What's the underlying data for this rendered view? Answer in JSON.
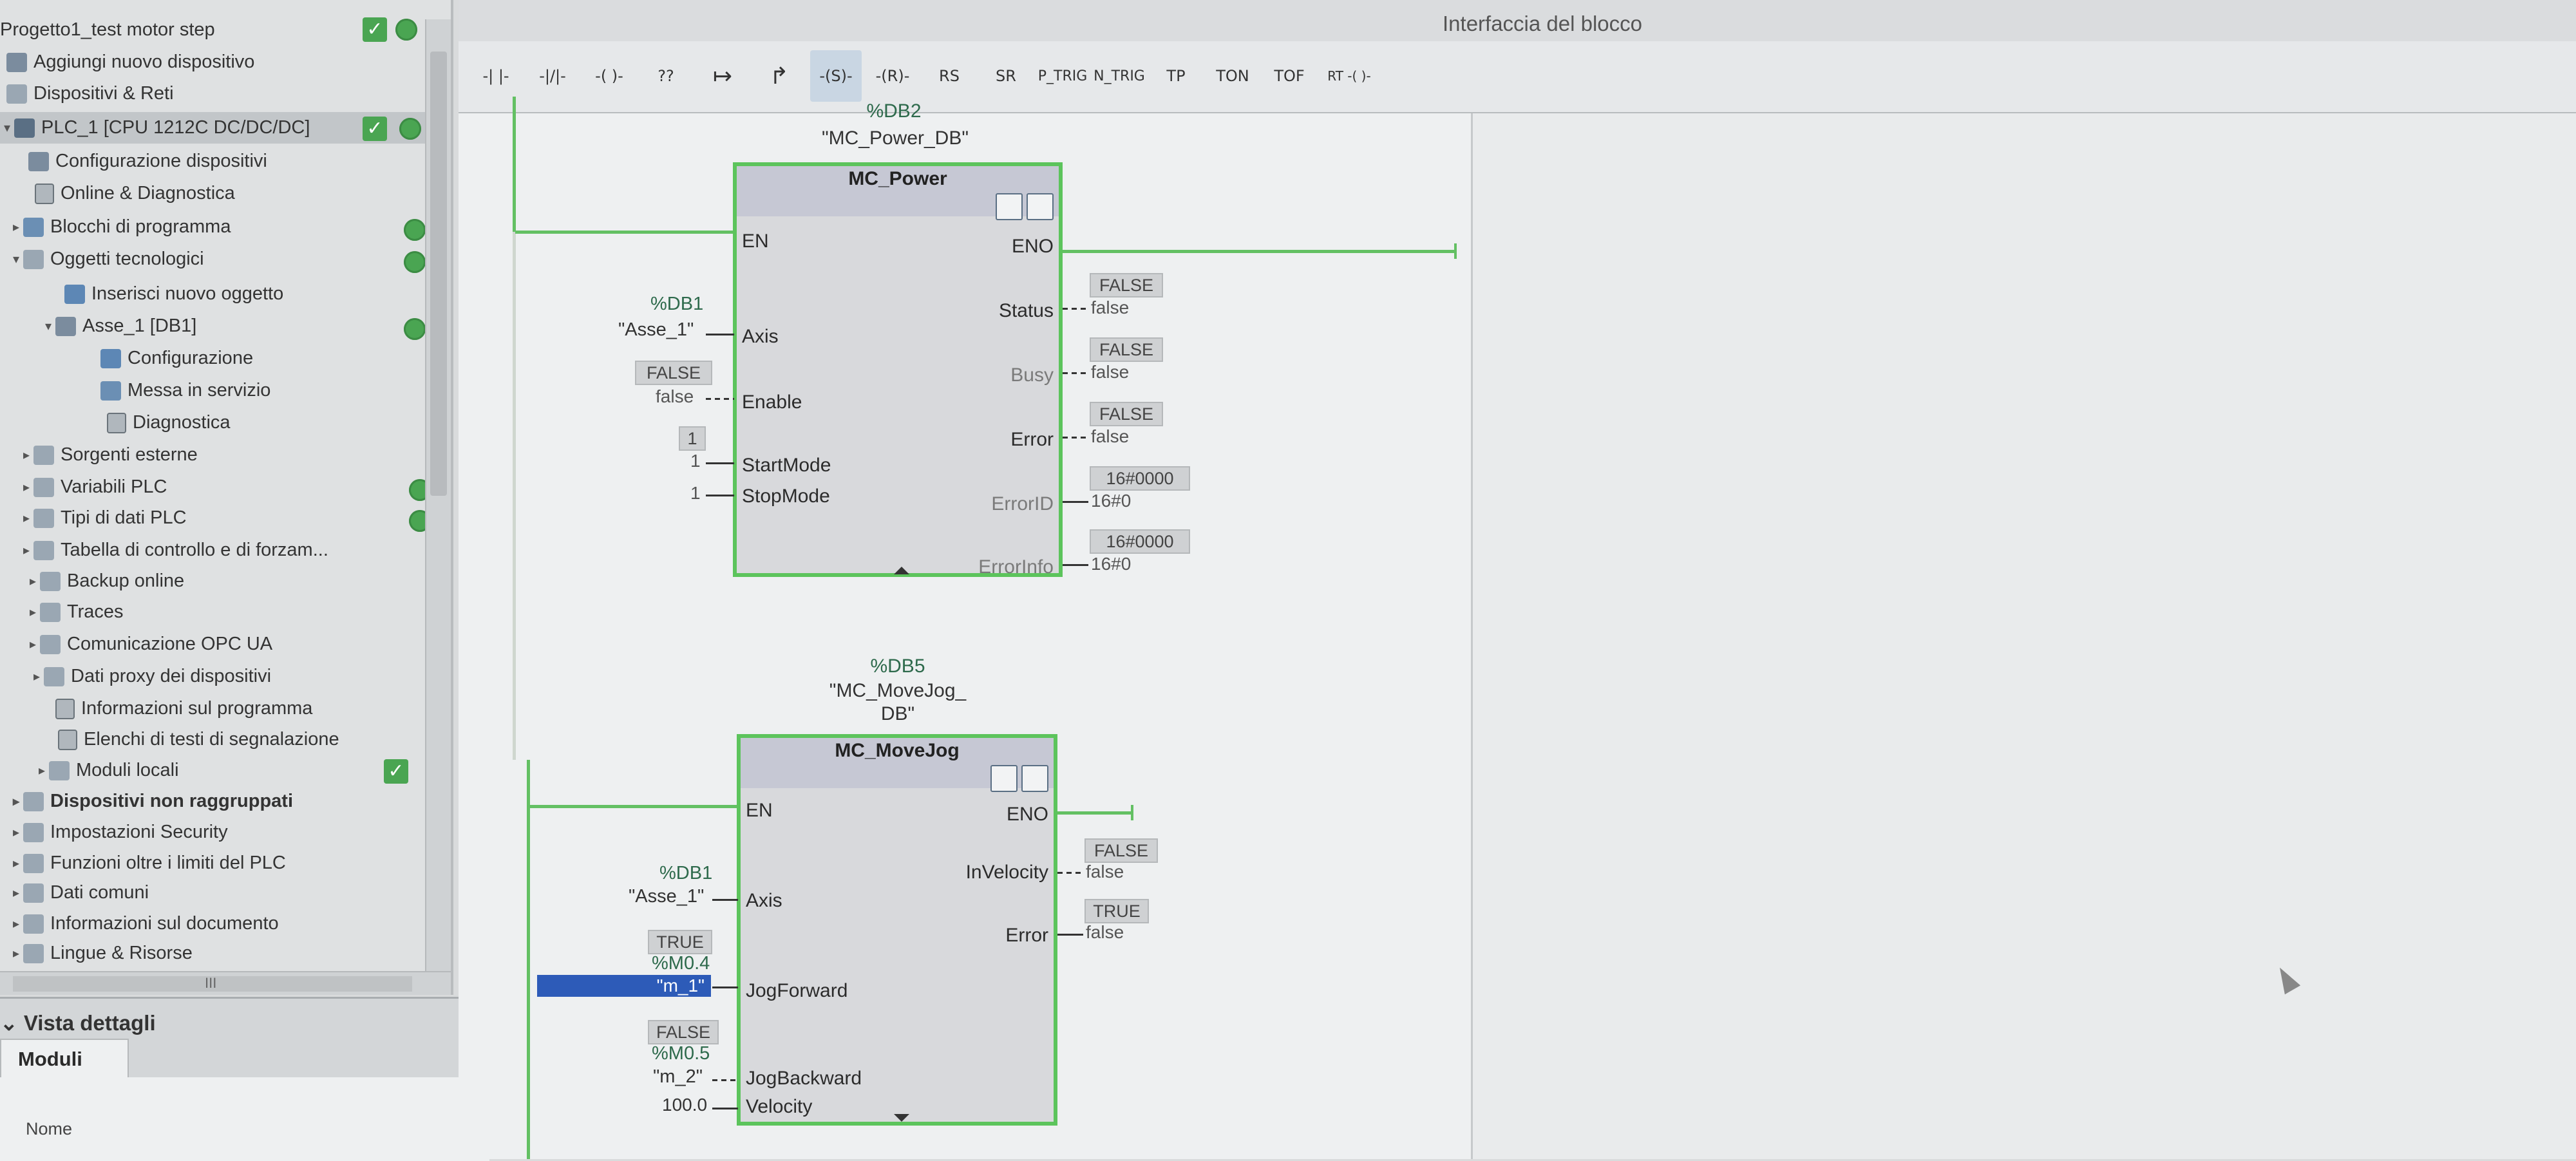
{
  "tree": {
    "project": "Progetto1_test motor step",
    "items": [
      {
        "label": "Aggiungi nuovo dispositivo"
      },
      {
        "label": "Dispositivi & Reti"
      },
      {
        "label": "PLC_1 [CPU 1212C DC/DC/DC]"
      },
      {
        "label": "Configurazione dispositivi"
      },
      {
        "label": "Online & Diagnostica"
      },
      {
        "label": "Blocchi di programma"
      },
      {
        "label": "Oggetti tecnologici"
      },
      {
        "label": "Inserisci nuovo oggetto"
      },
      {
        "label": "Asse_1 [DB1]"
      },
      {
        "label": "Configurazione"
      },
      {
        "label": "Messa in servizio"
      },
      {
        "label": "Diagnostica"
      },
      {
        "label": "Sorgenti esterne"
      },
      {
        "label": "Variabili PLC"
      },
      {
        "label": "Tipi di dati PLC"
      },
      {
        "label": "Tabella di controllo e di forzam..."
      },
      {
        "label": "Backup online"
      },
      {
        "label": "Traces"
      },
      {
        "label": "Comunicazione OPC UA"
      },
      {
        "label": "Dati proxy dei dispositivi"
      },
      {
        "label": "Informazioni sul programma"
      },
      {
        "label": "Elenchi di testi di segnalazione"
      },
      {
        "label": "Moduli locali"
      },
      {
        "label": "Dispositivi non raggruppati"
      },
      {
        "label": "Impostazioni Security"
      },
      {
        "label": "Funzioni oltre i limiti del PLC"
      },
      {
        "label": "Dati comuni"
      },
      {
        "label": "Informazioni sul documento"
      },
      {
        "label": "Lingue & Risorse"
      }
    ],
    "scroll_mark": "III"
  },
  "details": {
    "title": "Vista dettagli",
    "tab": "Moduli",
    "column": "Nome"
  },
  "toolbar": {
    "window_title": "Interfaccia del blocco",
    "buttons": [
      "-| |-",
      "-|/|-",
      "-( )-",
      "??",
      "↦",
      "↱",
      "-(S)-",
      "-(R)-",
      "RS",
      "SR",
      "P_TRIG",
      "N_TRIG",
      "TP",
      "TON",
      "TOF",
      "RT -( )-"
    ]
  },
  "power": {
    "db": "%DB2",
    "db_name": "\"MC_Power_DB\"",
    "title": "MC_Power",
    "en": "EN",
    "eno": "ENO",
    "axis_pin": "Axis",
    "axis_addr": "%DB1",
    "axis_name": "\"Asse_1\"",
    "enable_pin": "Enable",
    "enable_badge": "FALSE",
    "enable_val": "false",
    "startmode_pin": "StartMode",
    "startmode_badge": "1",
    "startmode_val": "1",
    "stopmode_pin": "StopMode",
    "stopmode_val": "1",
    "status_pin": "Status",
    "status_badge": "FALSE",
    "status_val": "false",
    "busy_pin": "Busy",
    "busy_badge": "FALSE",
    "busy_val": "false",
    "error_pin": "Error",
    "error_badge": "FALSE",
    "error_val": "false",
    "errorid_pin": "ErrorID",
    "errorid_badge": "16#0000",
    "errorid_val": "16#0",
    "errorinfo_pin": "ErrorInfo",
    "errorinfo_badge": "16#0000",
    "errorinfo_val": "16#0"
  },
  "jog": {
    "db": "%DB5",
    "db_name1": "\"MC_MoveJog_",
    "db_name2": "DB\"",
    "title": "MC_MoveJog",
    "en": "EN",
    "eno": "ENO",
    "axis_pin": "Axis",
    "axis_addr": "%DB1",
    "axis_name": "\"Asse_1\"",
    "fwd_pin": "JogForward",
    "fwd_badge": "TRUE",
    "fwd_addr": "%M0.4",
    "fwd_name": "\"m_1\"",
    "bwd_pin": "JogBackward",
    "bwd_badge": "FALSE",
    "bwd_addr": "%M0.5",
    "bwd_name": "\"m_2\"",
    "vel_pin": "Velocity",
    "vel_val": "100.0",
    "invel_pin": "InVelocity",
    "invel_badge": "FALSE",
    "invel_val": "false",
    "err_pin": "Error",
    "err_badge": "TRUE",
    "err_val": "false"
  }
}
